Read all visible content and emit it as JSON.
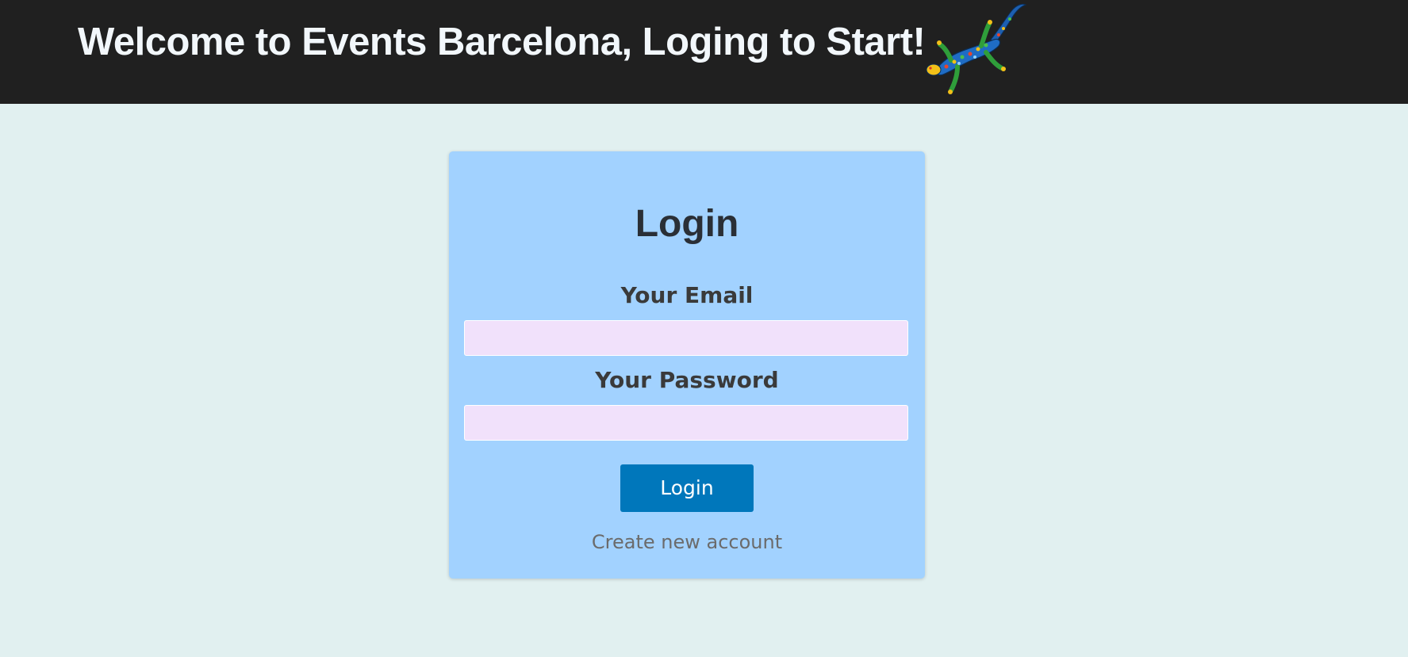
{
  "header": {
    "title": "Welcome to Events Barcelona, Loging to Start!",
    "logo_icon": "gecko-mosaic-icon"
  },
  "login_form": {
    "title": "Login",
    "email_label": "Your Email",
    "email_value": "",
    "password_label": "Your Password",
    "password_value": "",
    "submit_label": "Login",
    "create_account_link": "Create new account"
  },
  "colors": {
    "header_bg": "#202020",
    "page_bg": "#e1f0f0",
    "card_bg": "#a2d2ff",
    "input_bg": "#f1e1fb",
    "button_bg": "#0077bb"
  }
}
